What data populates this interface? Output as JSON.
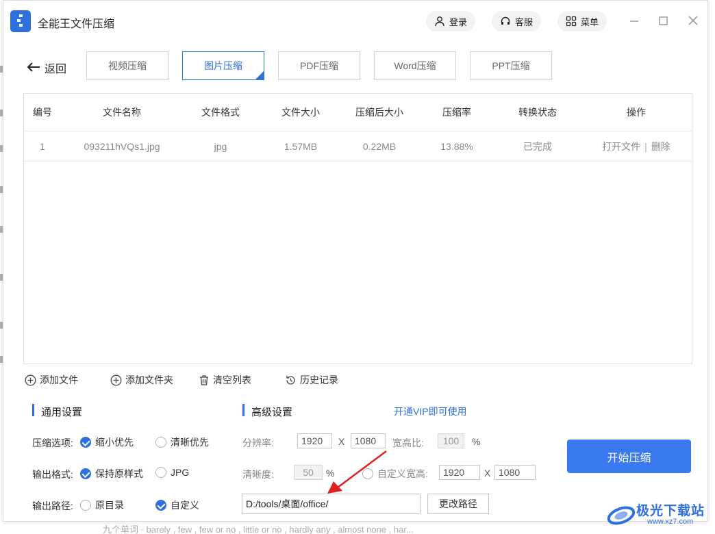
{
  "app": {
    "title": "全能王文件压缩"
  },
  "titlebar": {
    "login": "登录",
    "service": "客服",
    "menu": "菜单"
  },
  "nav": {
    "back": "返回"
  },
  "tabs": [
    {
      "label": "视频压缩"
    },
    {
      "label": "图片压缩"
    },
    {
      "label": "PDF压缩"
    },
    {
      "label": "Word压缩"
    },
    {
      "label": "PPT压缩"
    }
  ],
  "table": {
    "headers": [
      "编号",
      "文件名称",
      "文件格式",
      "文件大小",
      "压缩后大小",
      "压缩率",
      "转换状态",
      "操作"
    ],
    "rows": [
      {
        "index": "1",
        "name": "093211hVQs1.jpg",
        "format": "jpg",
        "size": "1.57MB",
        "compressed": "0.22MB",
        "ratio": "13.88%",
        "status": "已完成",
        "open": "打开文件",
        "sep": "|",
        "delete": "删除"
      }
    ]
  },
  "actions": {
    "add_file": "添加文件",
    "add_folder": "添加文件夹",
    "clear": "清空列表",
    "history": "历史记录"
  },
  "general": {
    "title": "通用设置",
    "compress_label": "压缩选项:",
    "compress_opt1": "缩小优先",
    "compress_opt2": "清晰优先",
    "format_label": "输出格式:",
    "format_opt1": "保持原样式",
    "format_opt2": "JPG",
    "path_label": "输出路径:",
    "path_opt1": "原目录",
    "path_opt2": "自定义"
  },
  "advanced": {
    "title": "高级设置",
    "vip": "开通VIP即可使用",
    "resolution_label": "分辨率:",
    "res_w": "1920",
    "res_x": "X",
    "res_h": "1080",
    "aspect_label": "宽高比:",
    "aspect_val": "100",
    "pct": "%",
    "clarity_label": "清晰度:",
    "clarity_val": "50",
    "custom_label": "自定义宽高:",
    "custom_w": "1920",
    "custom_h": "1080"
  },
  "path": {
    "value": "D:/tools/桌面/office/",
    "change": "更改路径"
  },
  "start": "开始压缩",
  "watermark": {
    "brand": "极光下载站",
    "url": "www.xz7.com"
  },
  "background": {
    "snippet": "九个单词 · barely , few , few or no , little or no , hardly any , almost none , har..."
  },
  "colors": {
    "accent": "#2f6fde",
    "start_button": "#3a7af0",
    "arrow": "#e02020"
  }
}
